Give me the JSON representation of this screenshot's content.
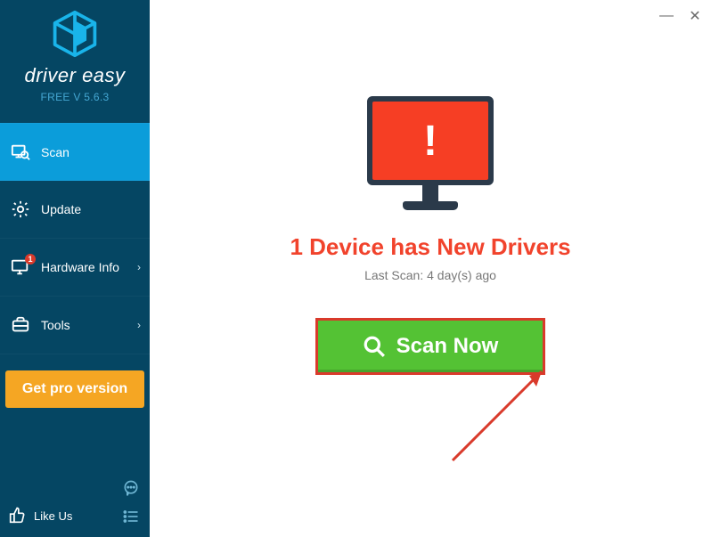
{
  "brand": {
    "name": "driver easy",
    "version_line": "FREE V 5.6.3"
  },
  "sidebar": {
    "items": [
      {
        "label": "Scan",
        "icon": "scan-icon",
        "active": true,
        "chevron": false
      },
      {
        "label": "Update",
        "icon": "gear-icon",
        "active": false,
        "chevron": false
      },
      {
        "label": "Hardware Info",
        "icon": "monitor-badge-icon",
        "active": false,
        "chevron": true,
        "badge": "1"
      },
      {
        "label": "Tools",
        "icon": "tools-icon",
        "active": false,
        "chevron": true
      }
    ],
    "get_pro": "Get pro version",
    "like_us": "Like Us"
  },
  "main": {
    "alert_glyph": "!",
    "headline": "1 Device has New Drivers",
    "last_scan": "Last Scan: 4 day(s) ago",
    "scan_button": "Scan Now"
  },
  "window": {
    "minimize": "—",
    "close": "✕"
  },
  "colors": {
    "sidebar": "#054663",
    "active": "#0b9dda",
    "pro": "#f5a623",
    "alert": "#f1432c",
    "scanbg": "#54c234",
    "scanborder": "#d93a2b"
  }
}
